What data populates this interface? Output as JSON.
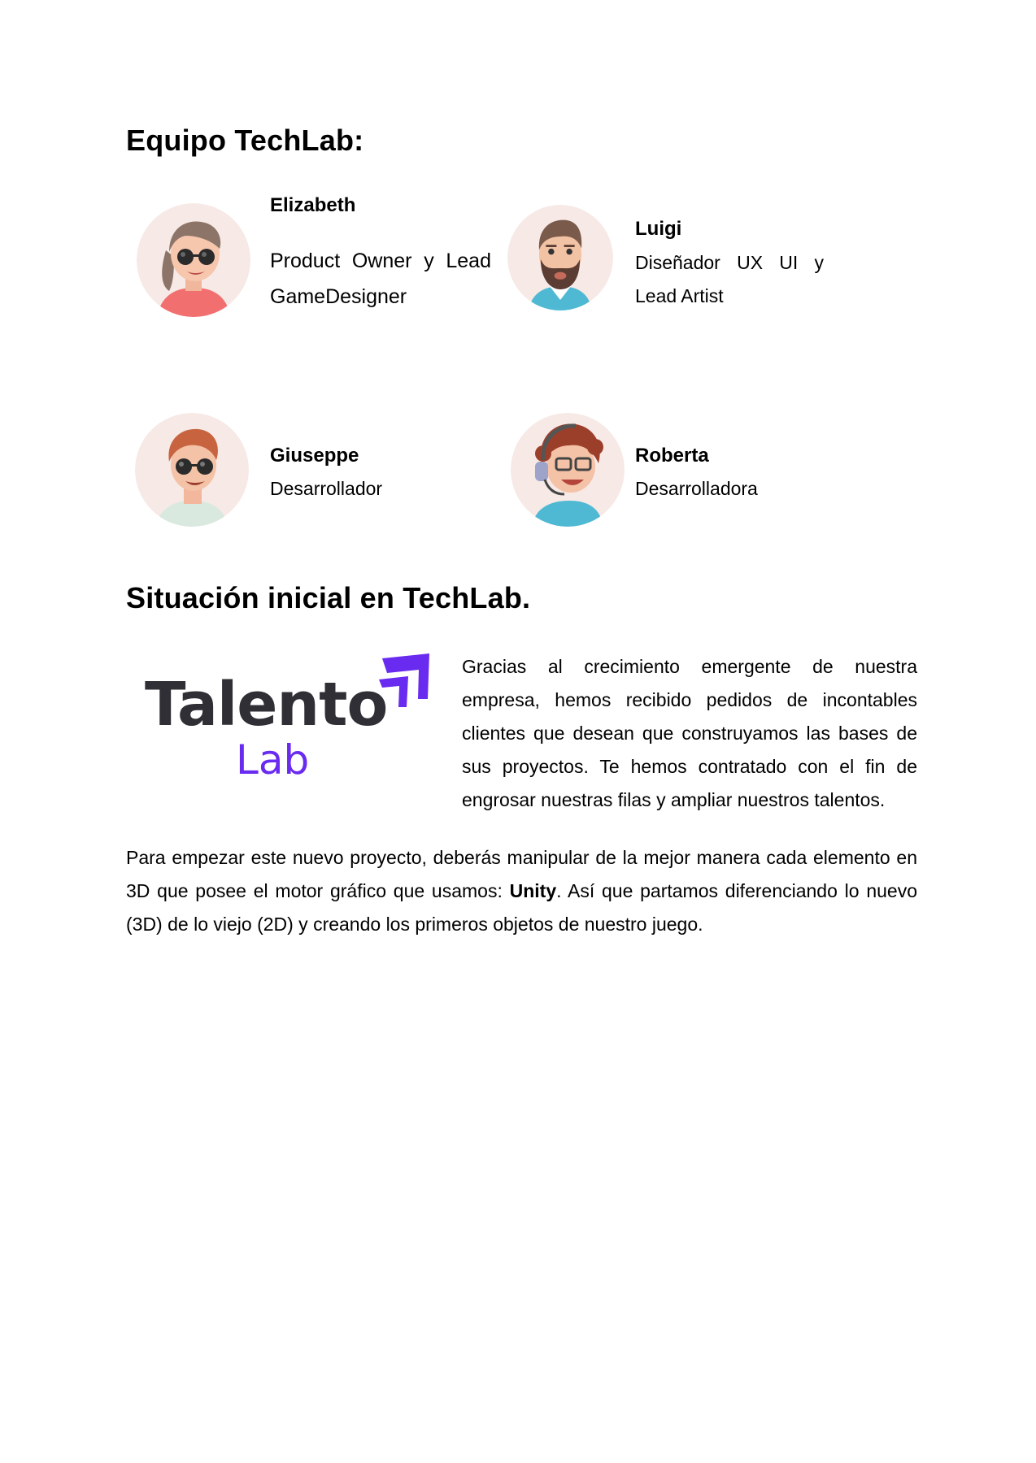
{
  "team_heading": "Equipo TechLab:",
  "members": [
    {
      "name": "Elizabeth",
      "role_line1": [
        "Product",
        "Owner",
        "y",
        "Lead"
      ],
      "role_line2": "GameDesigner",
      "avatar_icon": "avatar-woman-sunglasses-icon"
    },
    {
      "name": "Luigi",
      "role_line1": [
        "Diseñador",
        "UX",
        "UI",
        "y"
      ],
      "role_line2": "Lead Artist",
      "avatar_icon": "avatar-bearded-man-icon"
    },
    {
      "name": "Giuseppe",
      "role": "Desarrollador",
      "avatar_icon": "avatar-redhead-man-sunglasses-icon"
    },
    {
      "name": "Roberta",
      "role": "Desarrolladora",
      "avatar_icon": "avatar-woman-headset-icon"
    }
  ],
  "situation_heading": "Situación inicial en TechLab.",
  "logo": {
    "word1": "Talento",
    "word2": "Lab",
    "dark_color": "#2f2f35",
    "accent_color": "#6a2bf0"
  },
  "intro_text": "Gracias al crecimiento emergente de nuestra empresa, hemos recibido pedidos de incontables clientes que desean que construyamos las bases de sus proyectos. Te hemos contratado con el fin de engrosar nuestras filas y ampliar nuestros talentos.",
  "body_paragraph": {
    "before": "Para empezar este nuevo proyecto, deberás manipular de la mejor manera cada elemento en 3D que posee el motor gráfico que usamos: ",
    "bold": "Unity",
    "after": ". Así que partamos diferenciando lo nuevo (3D) de lo viejo (2D) y creando los primeros objetos de nuestro juego."
  }
}
